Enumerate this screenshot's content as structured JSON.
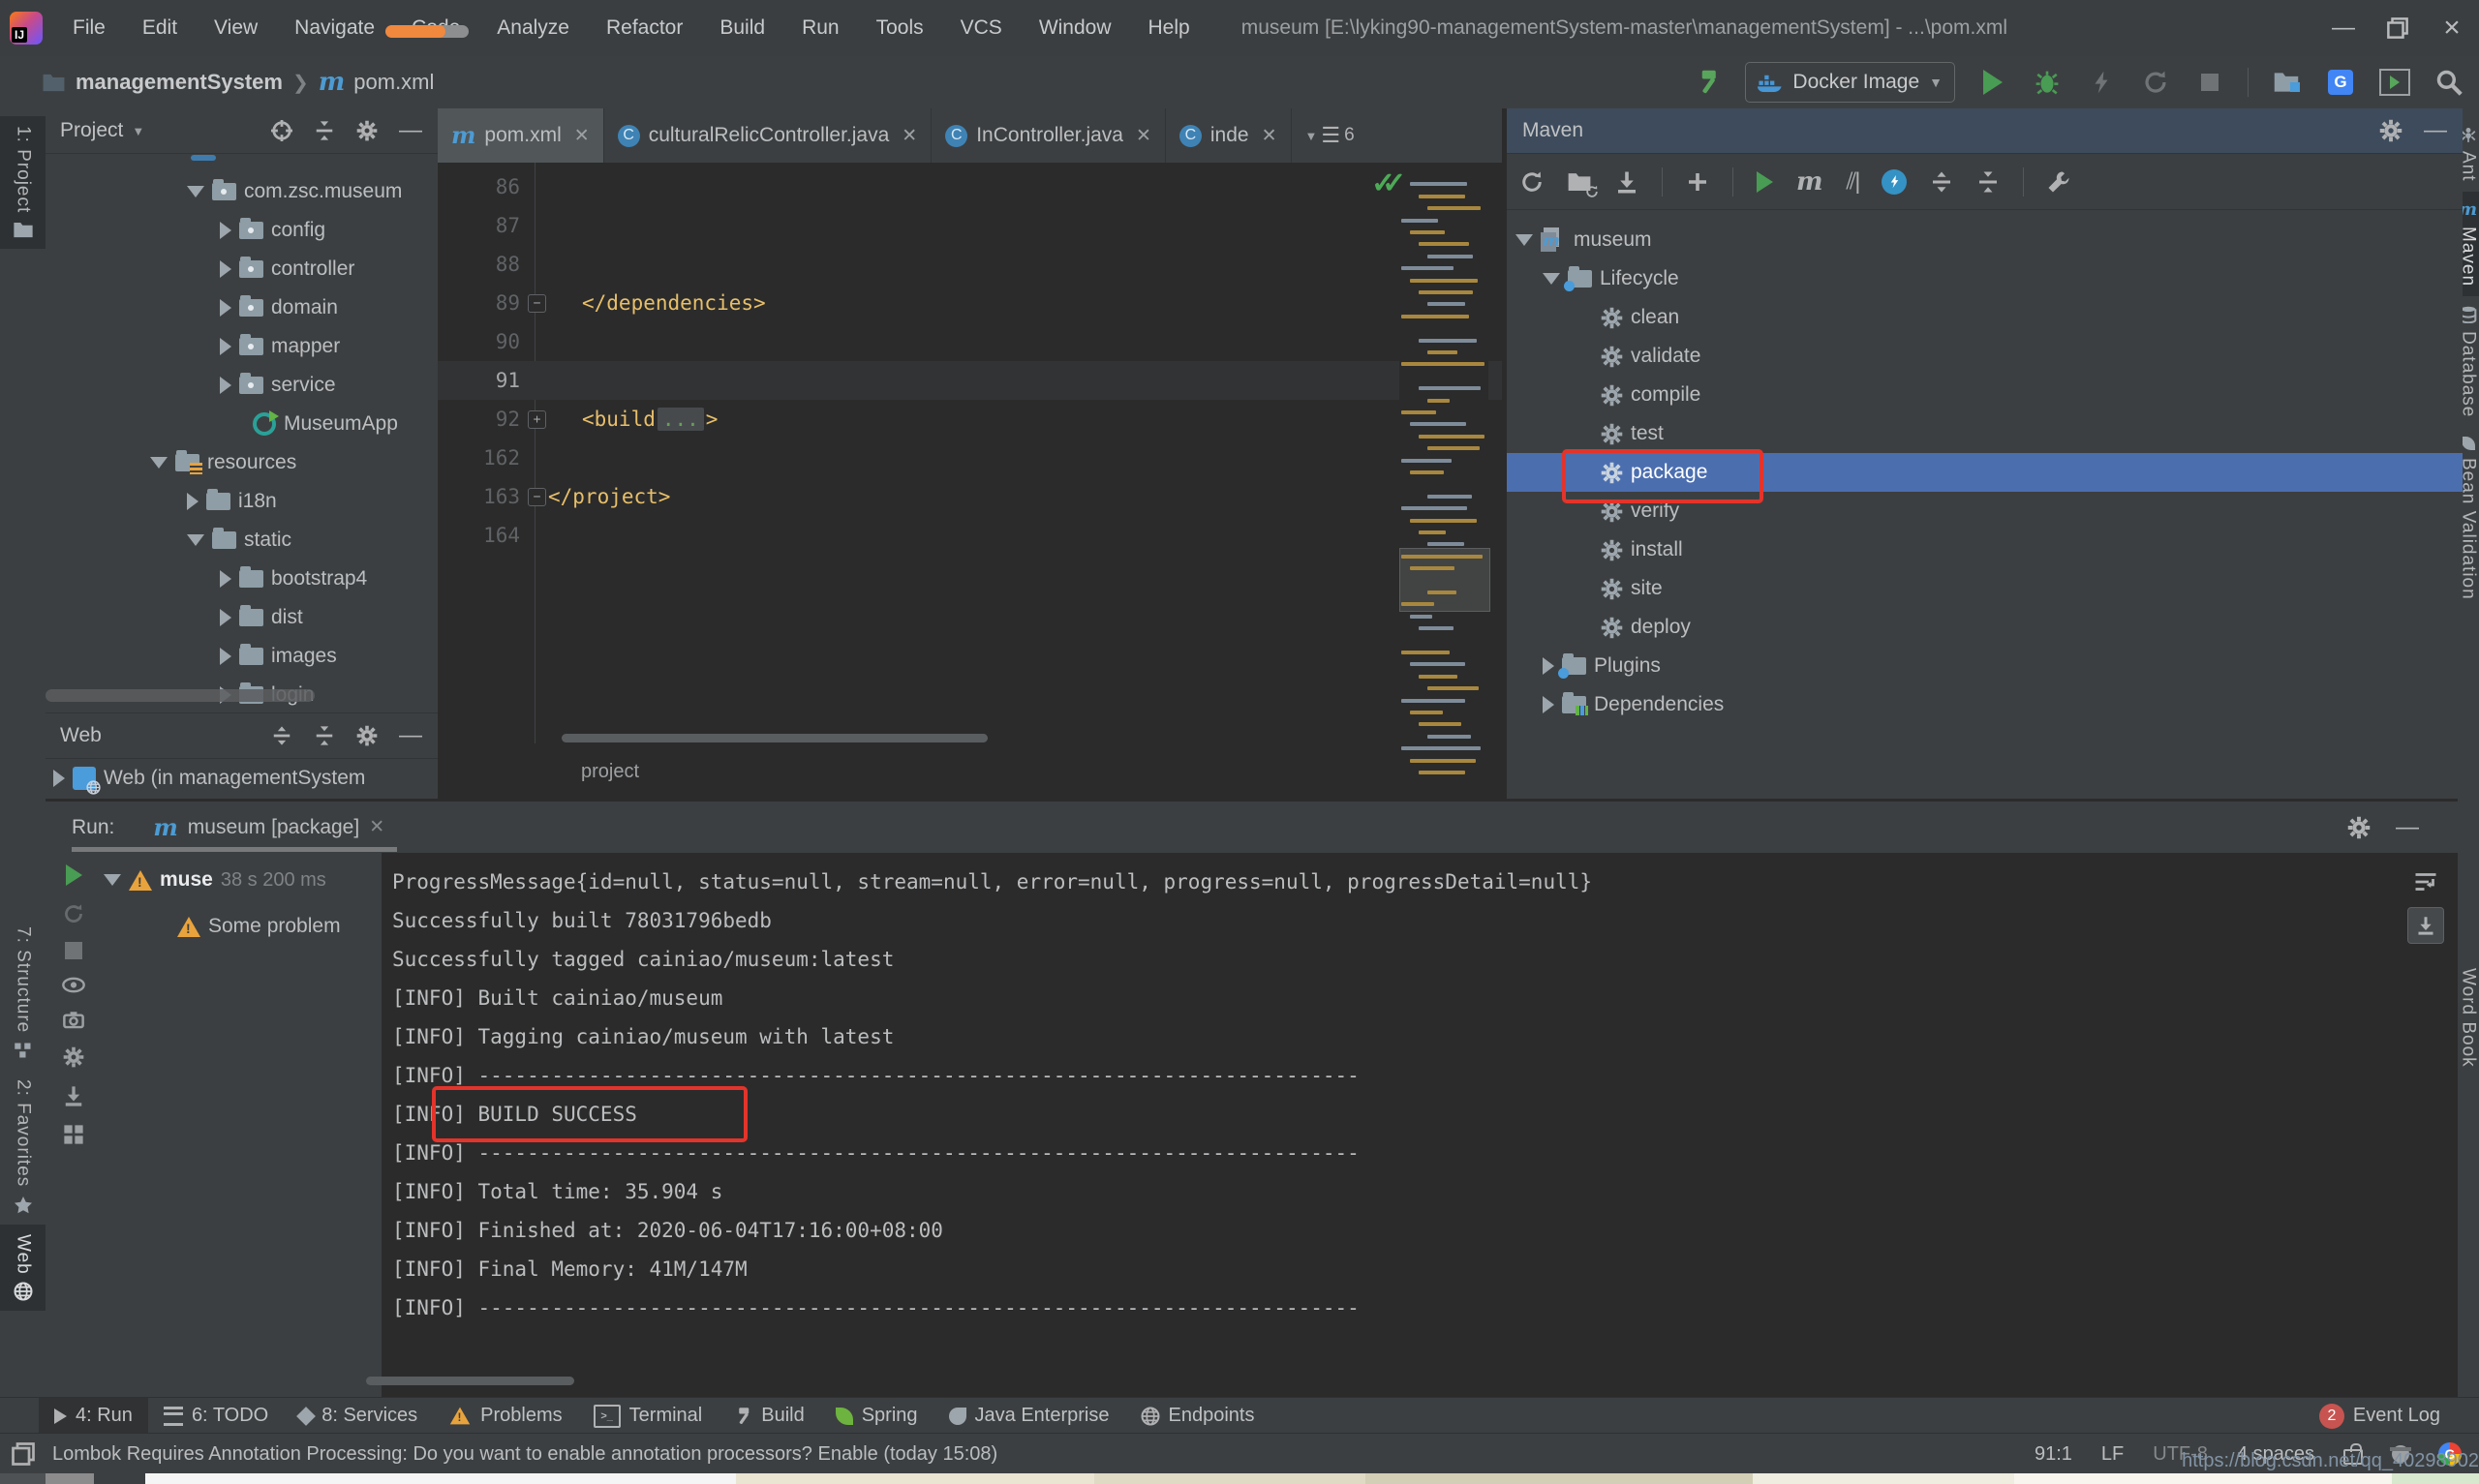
{
  "window": {
    "menu": [
      "File",
      "Edit",
      "View",
      "Navigate",
      "Code",
      "Analyze",
      "Refactor",
      "Build",
      "Run",
      "Tools",
      "VCS",
      "Window",
      "Help"
    ],
    "title": "museum [E:\\lyking90-managementSystem-master\\managementSystem] - ...\\pom.xml",
    "progress_percent": 72
  },
  "nav": {
    "project": "managementSystem",
    "file": "pom.xml"
  },
  "toolbar": {
    "run_config": "Docker Image"
  },
  "stripes": {
    "left_project": "1: Project",
    "left_structure": "7: Structure",
    "left_favorites": "2: Favorites",
    "left_web": "Web",
    "right_ant": "Ant",
    "right_maven": "Maven",
    "right_database": "Database",
    "right_bean": "Bean Validation",
    "right_wordbook": "Word Book"
  },
  "project_panel": {
    "title": "Project",
    "items": [
      "com.zsc.museum",
      "config",
      "controller",
      "domain",
      "mapper",
      "service",
      "MuseumApp",
      "resources",
      "i18n",
      "static",
      "bootstrap4",
      "dist",
      "images",
      "login"
    ]
  },
  "web_panel": {
    "title": "Web",
    "item": "Web (in managementSystem"
  },
  "editor": {
    "tabs": [
      "pom.xml",
      "culturalRelicController.java",
      "InController.java",
      "inde"
    ],
    "hidden_tabs_count": "6",
    "line_numbers": [
      "86",
      "87",
      "88",
      "89",
      "90",
      "91",
      "92",
      "162",
      "163",
      "164"
    ],
    "code": {
      "dependencies_close": "</dependencies>",
      "build_open": "<build",
      "fold_ellipsis": "...",
      "build_close": ">",
      "project_close": "</project>"
    },
    "breadcrumb": "project"
  },
  "maven_panel": {
    "title": "Maven",
    "items": [
      "museum",
      "Lifecycle",
      "clean",
      "validate",
      "compile",
      "test",
      "package",
      "verify",
      "install",
      "site",
      "deploy",
      "Plugins",
      "Dependencies"
    ]
  },
  "run_panel": {
    "label": "Run:",
    "tab": "museum [package]",
    "node": "muse",
    "node_time": "38 s 200 ms",
    "node_child": "Some problem",
    "console_lines": [
      "ProgressMessage{id=null, status=null, stream=null, error=null, progress=null, progressDetail=null}",
      "Successfully built 78031796bedb",
      "Successfully tagged cainiao/museum:latest",
      "[INFO] Built cainiao/museum",
      "[INFO] Tagging cainiao/museum with latest",
      "[INFO] ------------------------------------------------------------------------",
      "[INFO] BUILD SUCCESS",
      "[INFO] ------------------------------------------------------------------------",
      "[INFO] Total time: 35.904 s",
      "[INFO] Finished at: 2020-06-04T17:16:00+08:00",
      "[INFO] Final Memory: 41M/147M",
      "[INFO] ------------------------------------------------------------------------"
    ]
  },
  "bottom_bar": {
    "items": [
      "4: Run",
      "6: TODO",
      "8: Services",
      "Problems",
      "Terminal",
      "Build",
      "Spring",
      "Java Enterprise",
      "Endpoints"
    ],
    "event_log": "Event Log",
    "badge": "2"
  },
  "status_bar": {
    "message": "Lombok Requires Annotation Processing: Do you want to enable annotation processors? Enable (today 15:08)",
    "caret": "91:1",
    "line_sep": "LF",
    "encoding": "UTF-8",
    "indent": "4 spaces"
  },
  "watermark": "https://blog.csdn.net/qq_40298902",
  "colors": {
    "selection_blue": "#4B6EAF",
    "annotation_red": "#E3342B",
    "minimap_yellow": "#A8873E",
    "minimap_grey": "#7E8B99"
  }
}
